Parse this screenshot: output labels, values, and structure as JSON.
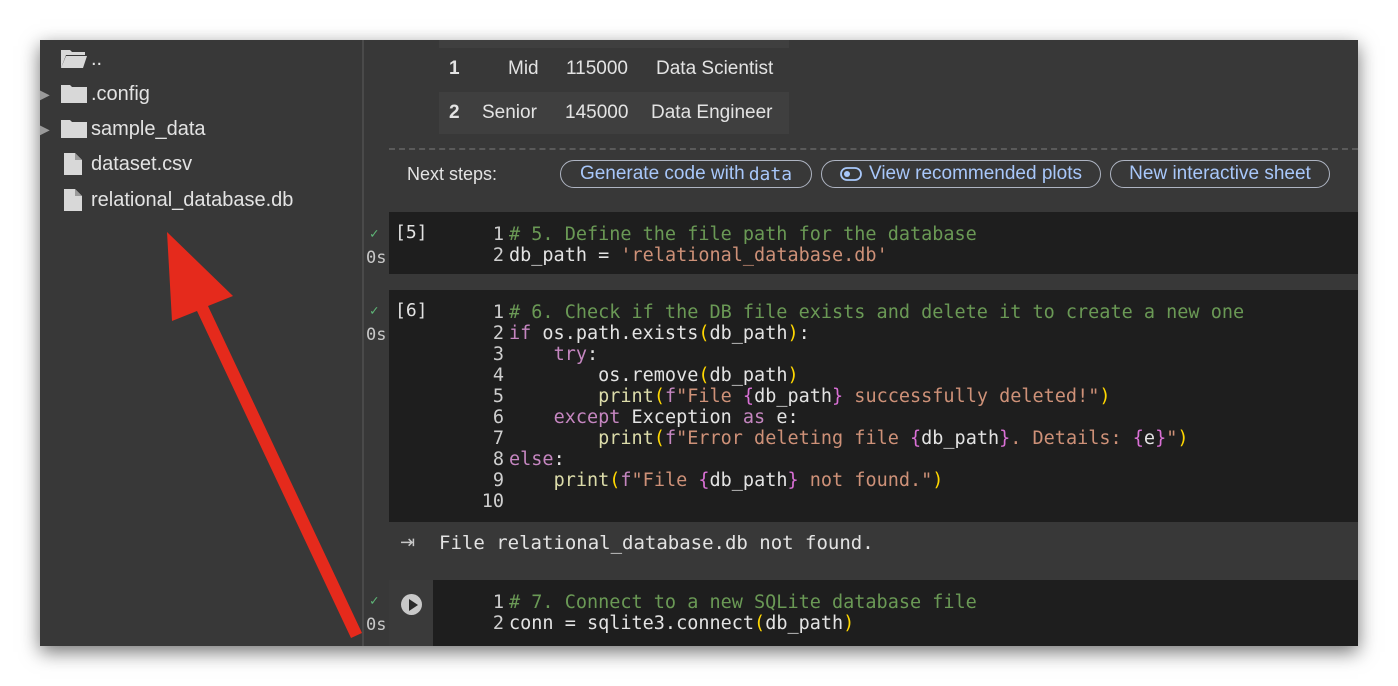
{
  "sidebar": {
    "items": [
      {
        "label": "..",
        "type": "folder-open",
        "expandable": false
      },
      {
        "label": ".config",
        "type": "folder",
        "expandable": true
      },
      {
        "label": "sample_data",
        "type": "folder",
        "expandable": true
      },
      {
        "label": "dataset.csv",
        "type": "file",
        "expandable": false
      },
      {
        "label": "relational_database.db",
        "type": "file",
        "expandable": false
      }
    ]
  },
  "table": {
    "rows": [
      {
        "index": "1",
        "level": "Mid",
        "salary": "115000",
        "role": "Data Scientist"
      },
      {
        "index": "2",
        "level": "Senior",
        "salary": "145000",
        "role": "Data Engineer"
      }
    ]
  },
  "next_steps": {
    "label": "Next steps:",
    "chip_generate_prefix": "Generate code with ",
    "chip_generate_var": "data",
    "chip_plots": "View recommended plots",
    "chip_sheet": "New interactive sheet"
  },
  "cells": {
    "cell5": {
      "count": "[5]",
      "time": "0s",
      "status": "✓"
    },
    "cell6": {
      "count": "[6]",
      "time": "0s",
      "status": "✓",
      "output": "File relational_database.db not found."
    },
    "cell7": {
      "time": "0s",
      "status": "✓"
    }
  },
  "icons": {
    "folder": "folder-icon",
    "folder_open": "folder-open-icon",
    "file": "file-icon",
    "run": "play-icon",
    "output": "output-toggle-icon",
    "plots": "toggle-icon"
  },
  "colors": {
    "background": "#383838",
    "code_bg": "#1e1e1e",
    "comment": "#6a9955",
    "keyword": "#c586c0",
    "string": "#ce9178",
    "chip_text": "#a8c7fa",
    "arrow": "#e52a1c"
  }
}
